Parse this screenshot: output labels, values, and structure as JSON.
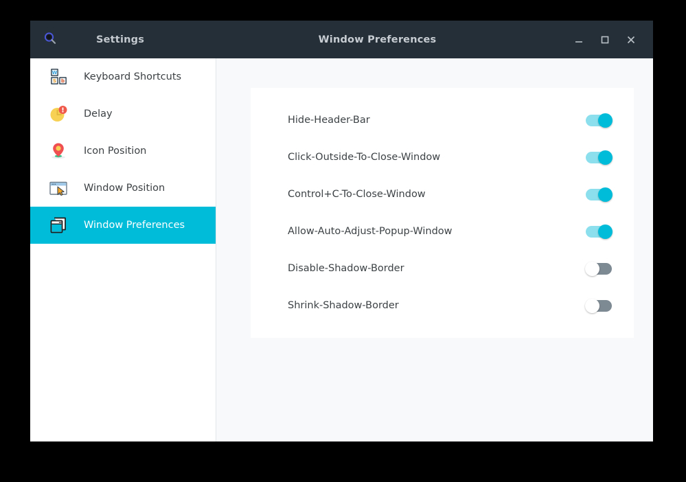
{
  "window": {
    "app_title": "Settings",
    "page_title": "Window Preferences",
    "search_icon": "search-icon",
    "controls": {
      "minimize": "minimize-icon",
      "maximize": "maximize-icon",
      "close": "close-icon"
    },
    "colors": {
      "titlebar_bg": "#242f38",
      "accent": "#00bcd9",
      "toggle_on_track": "#8ce0ed",
      "toggle_off_track": "#7e8a93",
      "content_bg": "#f7f9fb",
      "card_bg": "#ffffff"
    }
  },
  "sidebar": {
    "items": [
      {
        "label": "Keyboard Shortcuts",
        "icon": "keyboard-shortcuts-icon",
        "selected": false
      },
      {
        "label": "Delay",
        "icon": "clock-delay-icon",
        "selected": false
      },
      {
        "label": "Icon Position",
        "icon": "map-pin-icon",
        "selected": false
      },
      {
        "label": "Window Position",
        "icon": "window-cursor-icon",
        "selected": false
      },
      {
        "label": "Window Preferences",
        "icon": "windows-stack-icon",
        "selected": true
      }
    ]
  },
  "main": {
    "preferences": [
      {
        "label": "Hide-Header-Bar",
        "state": "on"
      },
      {
        "label": "Click-Outside-To-Close-Window",
        "state": "on"
      },
      {
        "label": "Control+C-To-Close-Window",
        "state": "on"
      },
      {
        "label": "Allow-Auto-Adjust-Popup-Window",
        "state": "on"
      },
      {
        "label": "Disable-Shadow-Border",
        "state": "off"
      },
      {
        "label": "Shrink-Shadow-Border",
        "state": "off"
      }
    ]
  }
}
